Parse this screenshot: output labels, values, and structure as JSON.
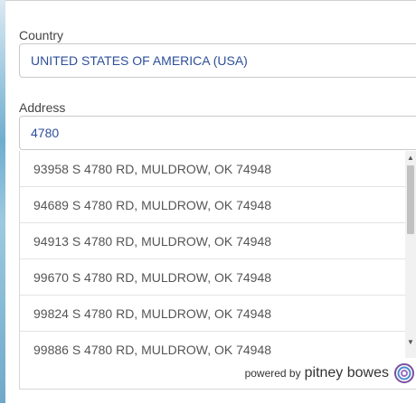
{
  "country": {
    "label": "Country",
    "value": "UNITED STATES OF AMERICA (USA)"
  },
  "address": {
    "label": "Address",
    "value": "4780"
  },
  "suggestions": [
    "93958 S 4780 RD, MULDROW, OK 74948",
    "94689 S 4780 RD, MULDROW, OK 74948",
    "94913 S 4780 RD, MULDROW, OK 74948",
    "99670 S 4780 RD, MULDROW, OK 74948",
    "99824 S 4780 RD, MULDROW, OK 74948",
    "99886 S 4780 RD, MULDROW, OK 74948"
  ],
  "footer": {
    "powered_by": "powered by",
    "brand": "pitney bowes",
    "logo_icon": "pitney-bowes-logo-icon"
  },
  "scroll": {
    "up_icon": "▲",
    "down_icon": "▼"
  }
}
